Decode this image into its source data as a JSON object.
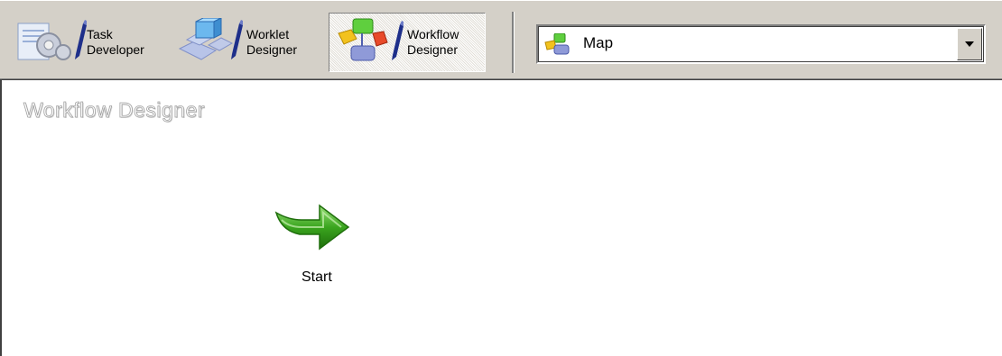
{
  "toolbar": {
    "buttons": [
      {
        "label": "Task\nDeveloper",
        "icon": "task-developer-icon",
        "active": false
      },
      {
        "label": "Worklet\nDesigner",
        "icon": "worklet-designer-icon",
        "active": false
      },
      {
        "label": "Workflow\nDesigner",
        "icon": "workflow-designer-icon",
        "active": true
      }
    ]
  },
  "combo": {
    "selected": "Map",
    "icon": "map-icon"
  },
  "canvas": {
    "title": "Workflow Designer",
    "start": {
      "label": "Start",
      "icon": "start-arrow-icon",
      "color": "#3aa51e"
    }
  }
}
